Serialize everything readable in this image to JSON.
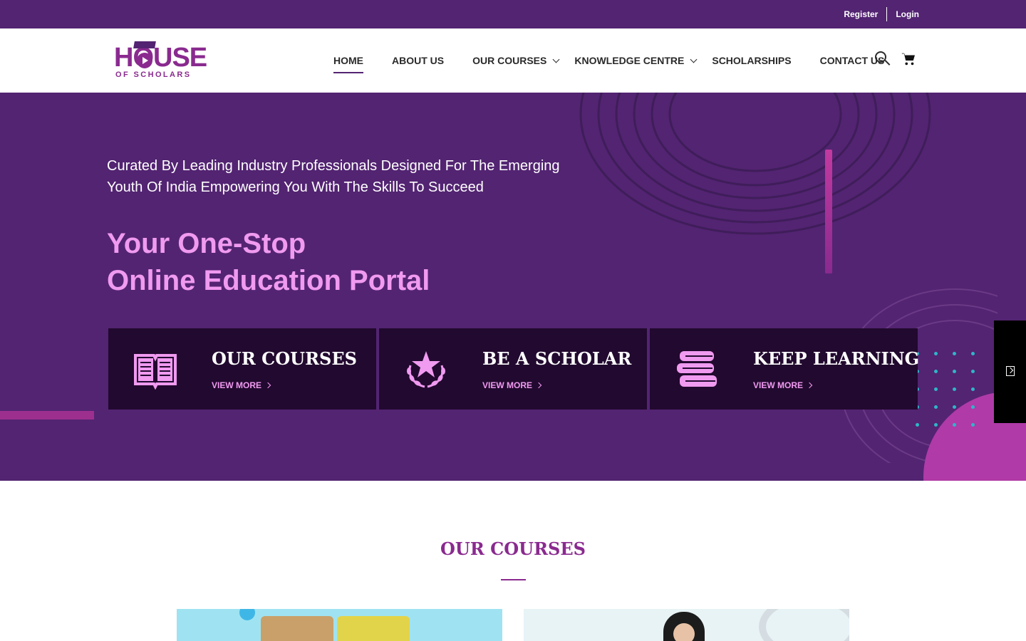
{
  "topbar": {
    "register": "Register",
    "login": "Login"
  },
  "logo": {
    "line1": "HOUSE",
    "line2": "OF SCHOLARS"
  },
  "nav": {
    "items": [
      {
        "label": "HOME",
        "active": true,
        "dropdown": false
      },
      {
        "label": "ABOUT US",
        "active": false,
        "dropdown": false
      },
      {
        "label": "OUR COURSES",
        "active": false,
        "dropdown": true
      },
      {
        "label": "KNOWLEDGE CENTRE",
        "active": false,
        "dropdown": true
      },
      {
        "label": "SCHOLARSHIPS",
        "active": false,
        "dropdown": false
      },
      {
        "label": "CONTACT US",
        "active": false,
        "dropdown": false
      }
    ],
    "icons": [
      "search-icon",
      "cart-icon"
    ]
  },
  "hero": {
    "subtitle": "Curated By Leading Industry Professionals Designed For The Emerging Youth Of India Empowering You With The Skills To Succeed",
    "title_line1": "Your One-Stop",
    "title_line2": "Online Education Portal",
    "cards": [
      {
        "title": "OUR COURSES",
        "link": "VIEW MORE",
        "icon": "book-icon"
      },
      {
        "title": "BE A SCHOLAR",
        "link": "VIEW MORE",
        "icon": "laurel-star-icon"
      },
      {
        "title": "KEEP LEARNING",
        "link": "VIEW MORE",
        "icon": "books-stack-icon"
      }
    ]
  },
  "section": {
    "title": "OUR COURSES"
  },
  "colors": {
    "brand_purple": "#532472",
    "accent_pink": "#f09af0",
    "card_bg": "#22092f",
    "heading": "#8a2a8f"
  }
}
